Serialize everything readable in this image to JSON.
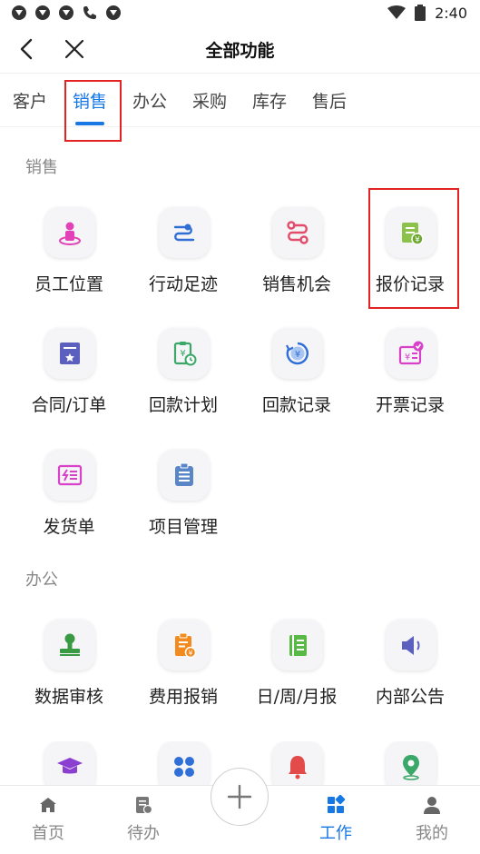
{
  "status_bar": {
    "time": "2:40"
  },
  "nav": {
    "title": "全部功能"
  },
  "tabs": [
    "客户",
    "销售",
    "办公",
    "采购",
    "库存",
    "售后"
  ],
  "sections": {
    "sales": {
      "title": "销售",
      "items": [
        "员工位置",
        "行动足迹",
        "销售机会",
        "报价记录",
        "合同/订单",
        "回款计划",
        "回款记录",
        "开票记录",
        "发货单",
        "项目管理"
      ]
    },
    "office": {
      "title": "办公",
      "items": [
        "数据审核",
        "费用报销",
        "日/周/月报",
        "内部公告"
      ]
    }
  },
  "bottom_nav": [
    "首页",
    "待办",
    "工作",
    "我的"
  ],
  "colors": {
    "accent": "#1677e5",
    "highlight": "#e32222"
  }
}
